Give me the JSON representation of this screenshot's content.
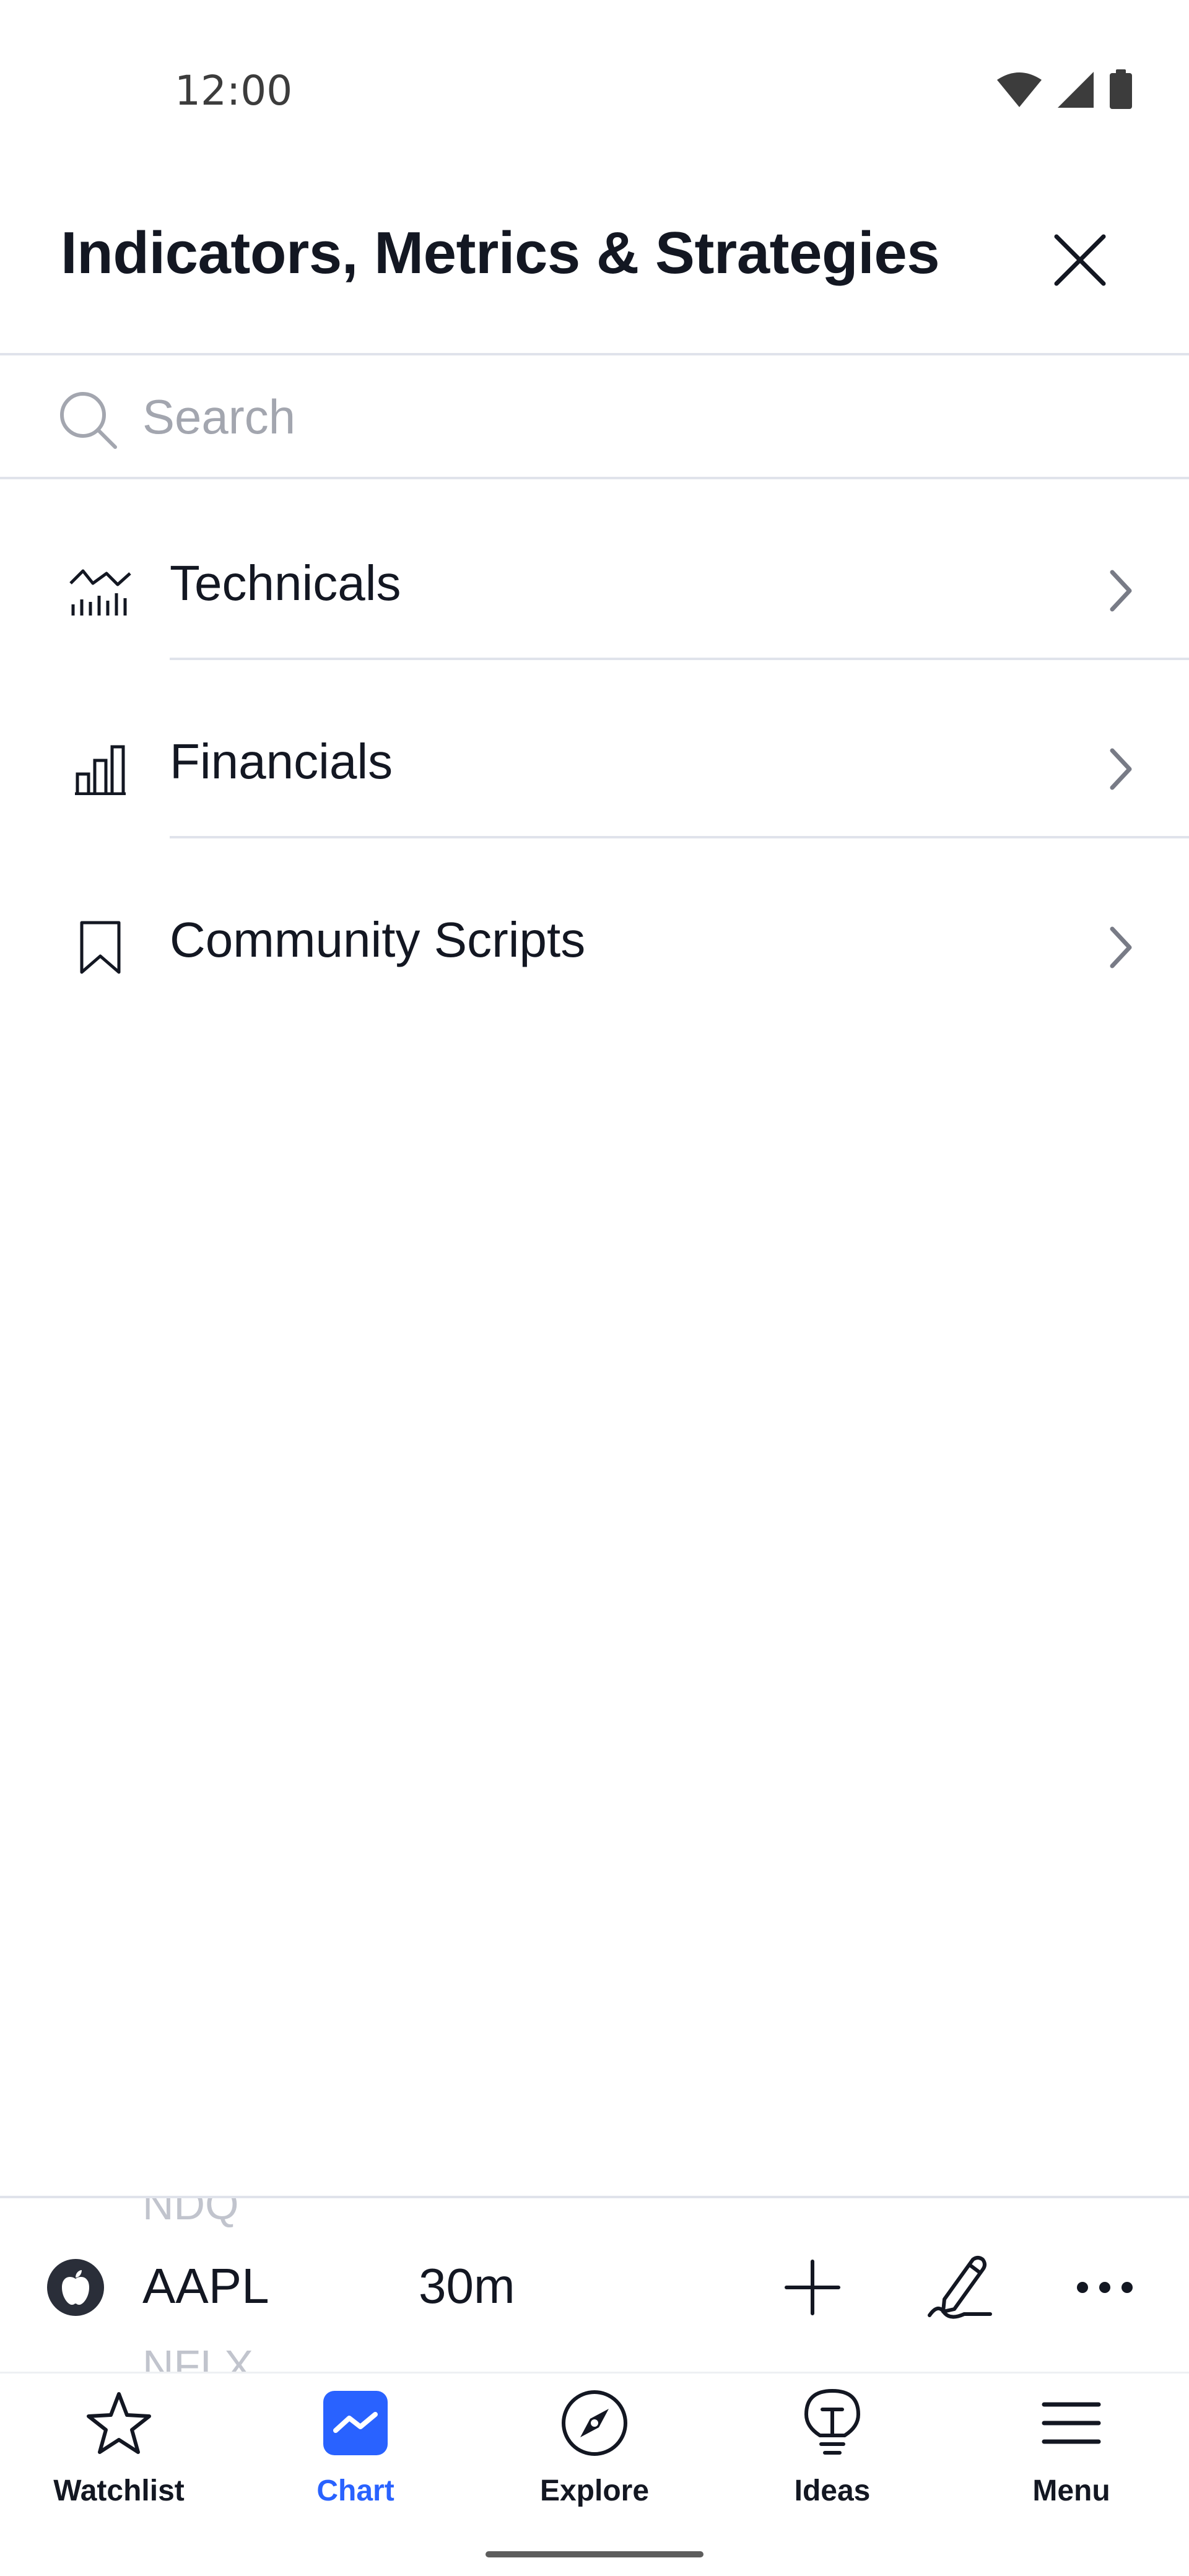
{
  "status_bar": {
    "time": "12:00",
    "icons": [
      "wifi-icon",
      "cellular-signal-icon",
      "battery-icon"
    ]
  },
  "header": {
    "title": "Indicators, Metrics & Strategies",
    "close_icon": "close-icon"
  },
  "search": {
    "placeholder": "Search",
    "value": ""
  },
  "categories": [
    {
      "label": "Technicals",
      "icon": "technicals-chart-icon"
    },
    {
      "label": "Financials",
      "icon": "financials-bar-chart-icon"
    },
    {
      "label": "Community Scripts",
      "icon": "bookmark-icon"
    }
  ],
  "toolbar": {
    "symbol": "AAPL",
    "symbol_prev": "NDQ",
    "symbol_next": "NFLX",
    "interval": "30m",
    "logo_icon": "apple-logo-icon",
    "actions": [
      "add-icon",
      "pencil-draw-icon",
      "more-dots-icon"
    ]
  },
  "bottom_nav": {
    "active": "Chart",
    "active_color": "#2962ff",
    "items": [
      {
        "label": "Watchlist",
        "icon": "star-icon"
      },
      {
        "label": "Chart",
        "icon": "chart-icon"
      },
      {
        "label": "Explore",
        "icon": "compass-icon"
      },
      {
        "label": "Ideas",
        "icon": "lightbulb-icon"
      },
      {
        "label": "Menu",
        "icon": "hamburger-menu-icon"
      }
    ]
  }
}
